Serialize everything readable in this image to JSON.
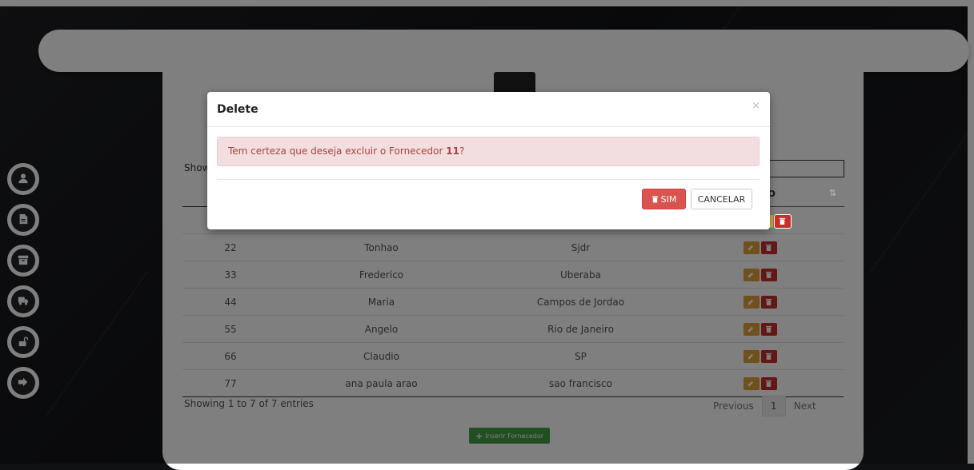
{
  "sidenav": {
    "items": [
      {
        "icon": "user-icon"
      },
      {
        "icon": "document-icon"
      },
      {
        "icon": "archive-icon"
      },
      {
        "icon": "truck-icon"
      },
      {
        "icon": "unlock-icon"
      },
      {
        "icon": "logout-icon"
      }
    ]
  },
  "table": {
    "show_label": "Show",
    "action_header": "AO",
    "rows": [
      {
        "id": "22",
        "nome": "Tonhao",
        "cidade": "Sjdr"
      },
      {
        "id": "33",
        "nome": "Frederico",
        "cidade": "Uberaba"
      },
      {
        "id": "44",
        "nome": "Maria",
        "cidade": "Campos de Jordao"
      },
      {
        "id": "55",
        "nome": "Angelo",
        "cidade": "Rio de Janeiro"
      },
      {
        "id": "66",
        "nome": "Claudio",
        "cidade": "SP"
      },
      {
        "id": "77",
        "nome": "ana paula arao",
        "cidade": "sao francisco"
      }
    ]
  },
  "footer": {
    "info": "Showing 1 to 7 of 7 entries",
    "previous": "Previous",
    "page": "1",
    "next": "Next",
    "insert_label": "Inserir Fornecedor"
  },
  "modal": {
    "title": "Delete",
    "close": "×",
    "message_prefix": "Tem certeza que deseja excluir o Fornecedor ",
    "message_id": "11",
    "message_suffix": "?",
    "confirm_label": "SIM",
    "cancel_label": "CANCELAR"
  },
  "colors": {
    "danger": "#d9534f",
    "warning": "#e0a33a",
    "success": "#449d44",
    "alert_bg": "#f2dede",
    "alert_text": "#a94442"
  }
}
